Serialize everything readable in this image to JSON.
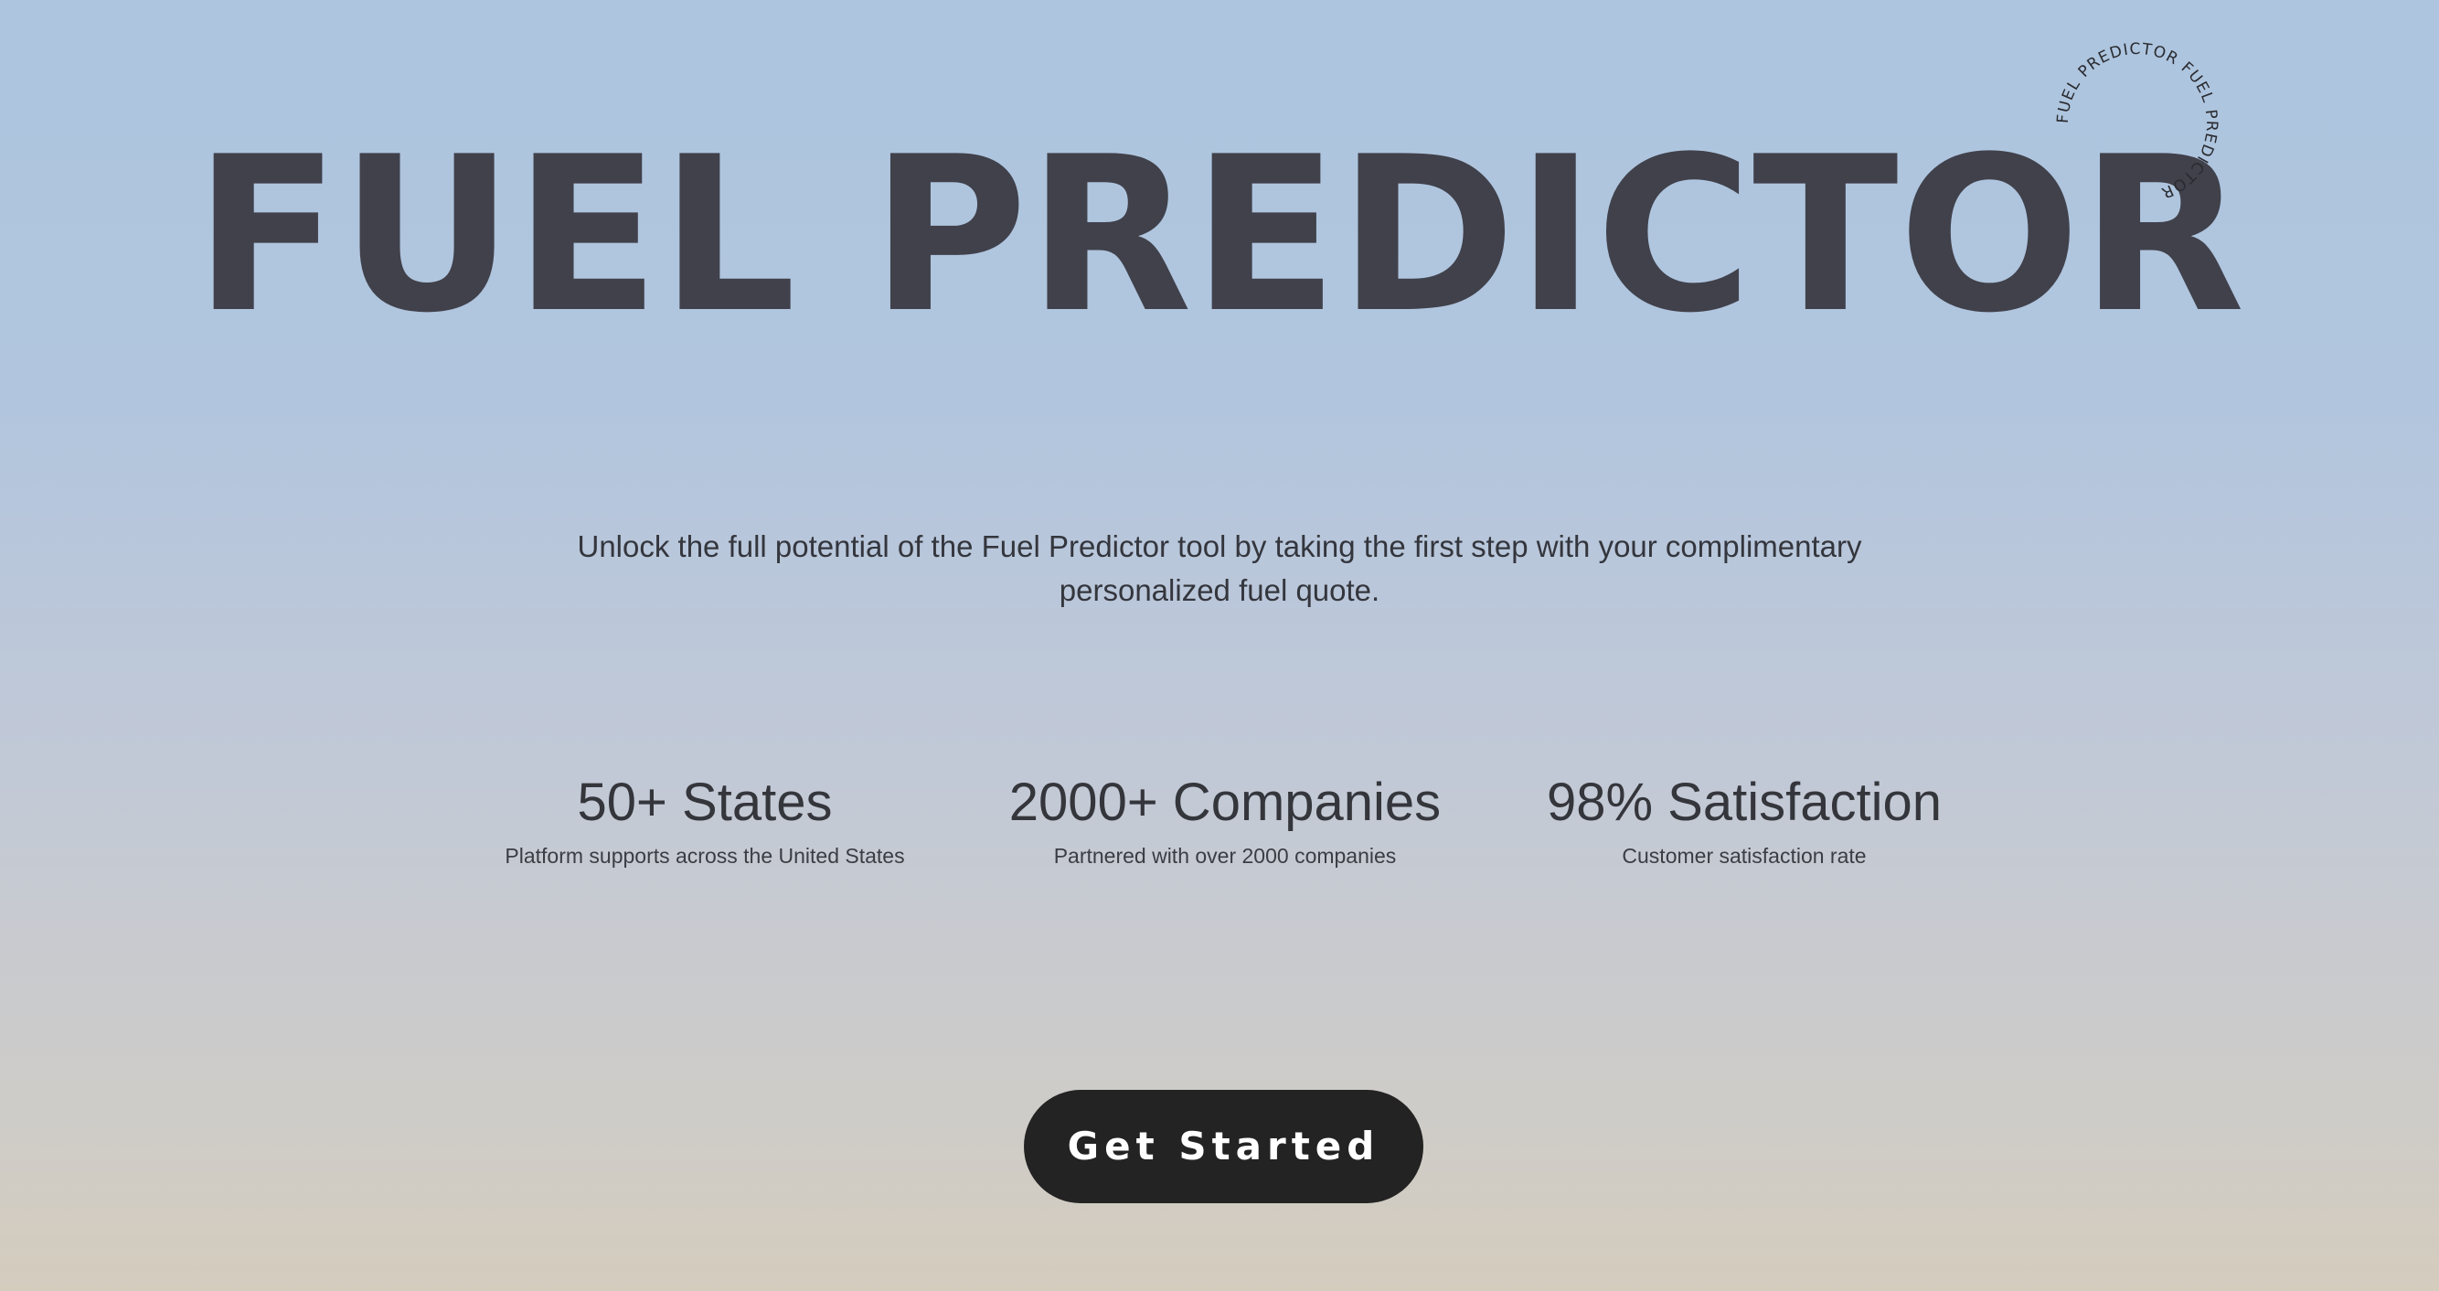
{
  "hero": {
    "title": "FUEL PREDICTOR",
    "badge_text": "FUEL PREDICTOR FUEL PREDICTOR "
  },
  "intro": {
    "text": "Unlock the full potential of the Fuel Predictor tool by taking the first step with your complimentary personalized fuel quote."
  },
  "stats": [
    {
      "value": "50+ States",
      "description": "Platform supports across the United States"
    },
    {
      "value": "2000+ Companies",
      "description": "Partnered with over 2000 companies"
    },
    {
      "value": "98% Satisfaction",
      "description": "Customer satisfaction rate"
    }
  ],
  "cta": {
    "label": "Get Started"
  },
  "colors": {
    "title": "#40414b",
    "button_bg": "#232323",
    "button_text": "#ffffff",
    "background_top": "#adc5df",
    "background_bottom": "#d4ccbd"
  }
}
